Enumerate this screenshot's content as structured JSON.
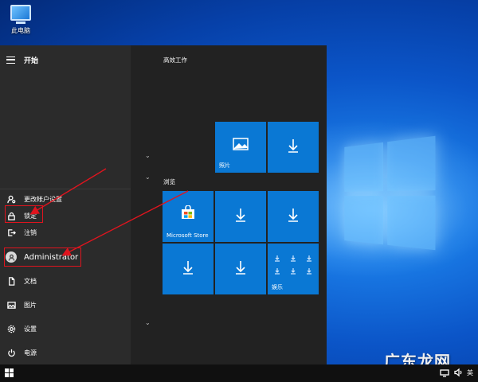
{
  "desktop": {
    "icon_label": "此电脑"
  },
  "start_menu": {
    "header": "开始",
    "account_flyout": {
      "change_settings": "更改帐户设置",
      "lock": "锁定",
      "sign_out": "注销"
    },
    "user": "Administrator",
    "rail_items": {
      "documents": "文档",
      "pictures": "图片",
      "settings": "设置",
      "power": "电源"
    },
    "groups": {
      "productivity": "高效工作",
      "browse": "浏览"
    },
    "tiles": {
      "photos": "照片",
      "store": "Microsoft Store",
      "entertainment": "娱乐"
    }
  },
  "taskbar": {
    "ime": "英"
  },
  "watermark": "广东龙网",
  "colors": {
    "tile": "#0a78d4",
    "menu_bg": "#222222",
    "highlight": "#e0141e"
  }
}
